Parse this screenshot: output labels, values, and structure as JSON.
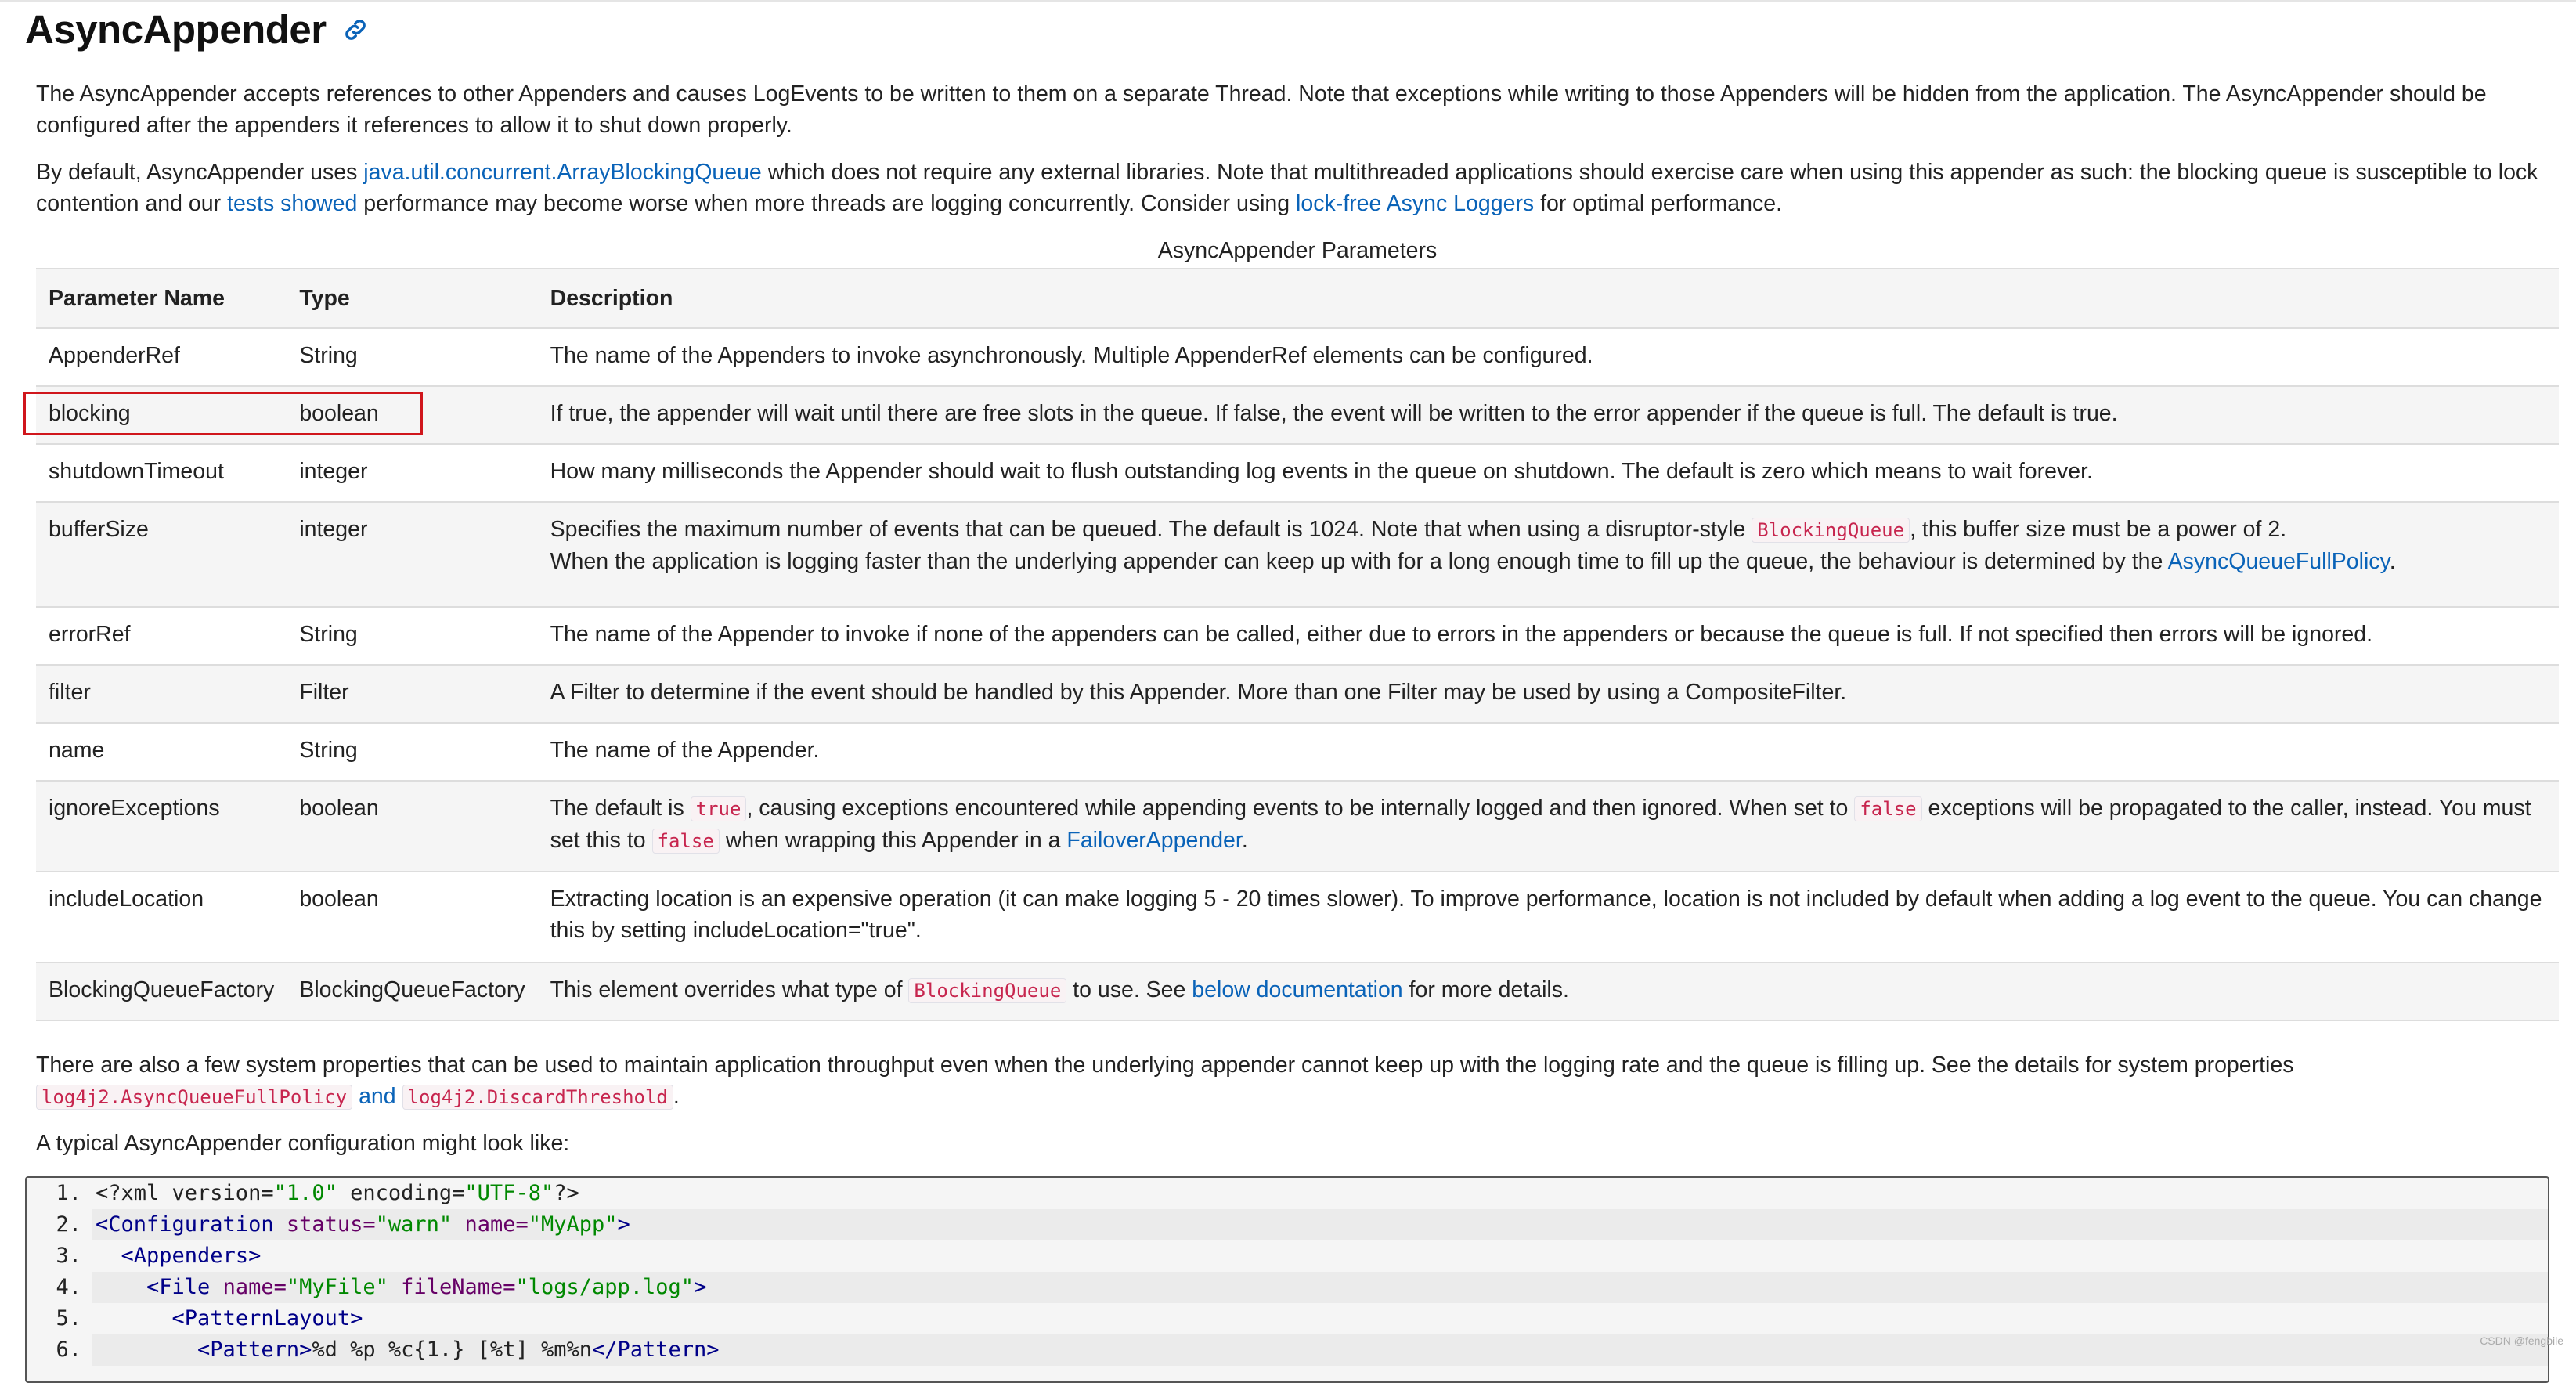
{
  "heading": "AsyncAppender",
  "intro1": "The AsyncAppender accepts references to other Appenders and causes LogEvents to be written to them on a separate Thread. Note that exceptions while writing to those Appenders will be hidden from the application. The AsyncAppender should be configured after the appenders it references to allow it to shut down properly.",
  "intro2": {
    "t1": "By default, AsyncAppender uses ",
    "link1": "java.util.concurrent.ArrayBlockingQueue",
    "t2": " which does not require any external libraries. Note that multithreaded applications should exercise care when using this appender as such: the blocking queue is susceptible to lock contention and our ",
    "link2": "tests showed",
    "t3": " performance may become worse when more threads are logging concurrently. Consider using ",
    "link3": "lock-free Async Loggers",
    "t4": " for optimal performance."
  },
  "table": {
    "caption": "AsyncAppender Parameters",
    "headers": [
      "Parameter Name",
      "Type",
      "Description"
    ],
    "rows": [
      {
        "name": "AppenderRef",
        "type": "String",
        "desc": "The name of the Appenders to invoke asynchronously. Multiple AppenderRef elements can be configured."
      },
      {
        "name": "blocking",
        "type": "boolean",
        "desc": "If true, the appender will wait until there are free slots in the queue. If false, the event will be written to the error appender if the queue is full. The default is true."
      },
      {
        "name": "shutdownTimeout",
        "type": "integer",
        "desc": "How many milliseconds the Appender should wait to flush outstanding log events in the queue on shutdown. The default is zero which means to wait forever."
      },
      {
        "name": "bufferSize",
        "type": "integer",
        "desc_a": "Specifies the maximum number of events that can be queued. The default is 1024. Note that when using a disruptor-style ",
        "desc_code": "BlockingQueue",
        "desc_b": ", this buffer size must be a power of 2.",
        "desc_c": "When the application is logging faster than the underlying appender can keep up with for a long enough time to fill up the queue, the behaviour is determined by the ",
        "desc_link": "AsyncQueueFullPolicy",
        "desc_d": "."
      },
      {
        "name": "errorRef",
        "type": "String",
        "desc": "The name of the Appender to invoke if none of the appenders can be called, either due to errors in the appenders or because the queue is full. If not specified then errors will be ignored."
      },
      {
        "name": "filter",
        "type": "Filter",
        "desc": "A Filter to determine if the event should be handled by this Appender. More than one Filter may be used by using a CompositeFilter."
      },
      {
        "name": "name",
        "type": "String",
        "desc": "The name of the Appender."
      },
      {
        "name": "ignoreExceptions",
        "type": "boolean",
        "desc_a": "The default is ",
        "code1": "true",
        "desc_b": ", causing exceptions encountered while appending events to be internally logged and then ignored. When set to ",
        "code2": "false",
        "desc_c": " exceptions will be propagated to the caller, instead. You must set this to ",
        "code3": "false",
        "desc_d": " when wrapping this Appender in a ",
        "desc_link": "FailoverAppender",
        "desc_e": "."
      },
      {
        "name": "includeLocation",
        "type": "boolean",
        "desc": "Extracting location is an expensive operation (it can make logging 5 - 20 times slower). To improve performance, location is not included by default when adding a log event to the queue. You can change this by setting includeLocation=\"true\"."
      },
      {
        "name": "BlockingQueueFactory",
        "type": "BlockingQueueFactory",
        "desc_a": "This element overrides what type of ",
        "desc_code": "BlockingQueue",
        "desc_b": " to use. See ",
        "desc_link": "below documentation",
        "desc_c": " for more details."
      }
    ]
  },
  "sysprops": {
    "t1": "There are also a few system properties that can be used to maintain application throughput even when the underlying appender cannot keep up with the logging rate and the queue is filling up. See the details for system properties ",
    "code1": "log4j2.AsyncQueueFullPolicy",
    "and": "and",
    "code2": "log4j2.DiscardThreshold",
    "t2": "."
  },
  "typical": "A typical AsyncAppender configuration might look like:",
  "code": {
    "lines": [
      {
        "n": "1.",
        "indent": "",
        "parts": [
          [
            "plain",
            "<?xml version="
          ],
          [
            "val",
            "\"1.0\""
          ],
          [
            "plain",
            " encoding="
          ],
          [
            "val",
            "\"UTF-8\""
          ],
          [
            "plain",
            "?>"
          ]
        ]
      },
      {
        "n": "2.",
        "indent": "",
        "parts": [
          [
            "tag",
            "<Configuration"
          ],
          [
            "plain",
            " "
          ],
          [
            "attr",
            "status="
          ],
          [
            "val",
            "\"warn\""
          ],
          [
            "plain",
            " "
          ],
          [
            "attr",
            "name="
          ],
          [
            "val",
            "\"MyApp\""
          ],
          [
            "tag",
            ">"
          ]
        ]
      },
      {
        "n": "3.",
        "indent": "  ",
        "parts": [
          [
            "tag",
            "<Appenders>"
          ]
        ]
      },
      {
        "n": "4.",
        "indent": "    ",
        "parts": [
          [
            "tag",
            "<File"
          ],
          [
            "plain",
            " "
          ],
          [
            "attr",
            "name="
          ],
          [
            "val",
            "\"MyFile\""
          ],
          [
            "plain",
            " "
          ],
          [
            "attr",
            "fileName="
          ],
          [
            "val",
            "\"logs/app.log\""
          ],
          [
            "tag",
            ">"
          ]
        ]
      },
      {
        "n": "5.",
        "indent": "      ",
        "parts": [
          [
            "tag",
            "<PatternLayout>"
          ]
        ]
      },
      {
        "n": "6.",
        "indent": "        ",
        "parts": [
          [
            "tag",
            "<Pattern>"
          ],
          [
            "plain",
            "%d %p %c{1.} [%t] %m%n"
          ],
          [
            "tag",
            "</Pattern>"
          ]
        ]
      }
    ]
  },
  "watermark": "CSDN @fengbile"
}
